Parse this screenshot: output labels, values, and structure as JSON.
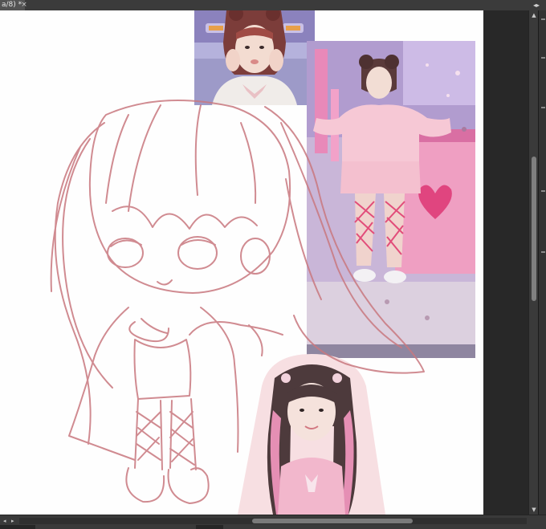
{
  "document_tab": {
    "title": "a/8) *",
    "close_glyph": "×"
  },
  "panel_controls": {
    "collapse_glyph": "◂▸"
  },
  "canvas": {
    "background_color": "#fefefe",
    "sketch_color": "#c9787f",
    "references": [
      {
        "name": "reference-photo-top",
        "alt": "Reference photo: girl with red bangs and space buns, hands near face"
      },
      {
        "name": "reference-photo-right",
        "alt": "Reference photo: full-body pose in pink outfit with heart background"
      },
      {
        "name": "reference-photo-bottom",
        "alt": "Reference photo: girl with long pink-streaked twin tails"
      }
    ]
  },
  "scrollbar": {
    "up_glyph": "▲",
    "down_glyph": "▼",
    "left_glyph": "◂",
    "right_glyph": "▸"
  }
}
